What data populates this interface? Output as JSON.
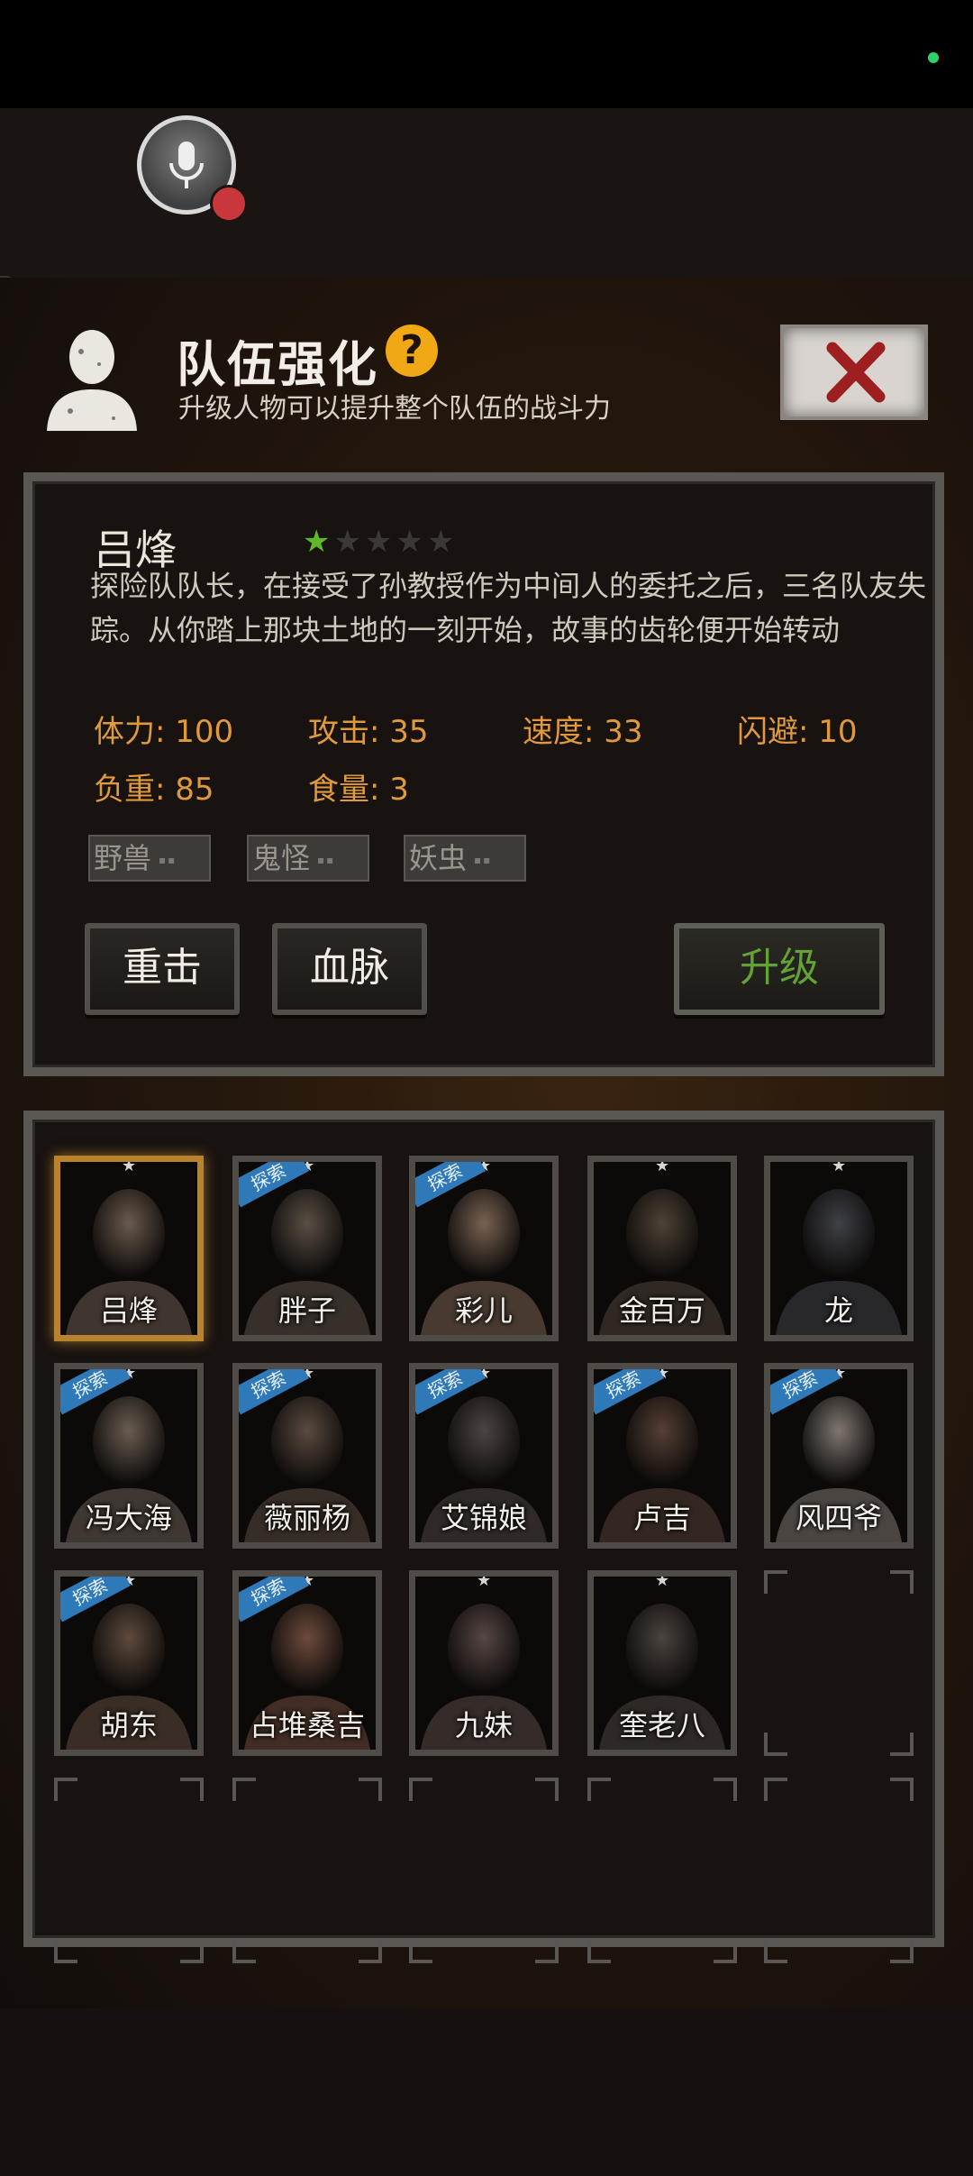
{
  "header": {
    "title": "队伍强化",
    "help_glyph": "?",
    "subtitle": "升级人物可以提升整个队伍的战斗力",
    "icons": [
      "profile-silhouette-icon",
      "help-icon",
      "close-icon",
      "microphone-muted-icon"
    ]
  },
  "character": {
    "name": "吕烽",
    "stars_total": 5,
    "stars_filled": 1,
    "description": "探险队队长，在接受了孙教授作为中间人的委托之后，三名队友失踪。从你踏上那块土地的一刻开始，故事的齿轮便开始转动",
    "stats": [
      {
        "label": "体力: 100"
      },
      {
        "label": "攻击: 35"
      },
      {
        "label": "速度: 33"
      },
      {
        "label": "闪避: 10"
      },
      {
        "label": "负重: 85"
      },
      {
        "label": "食量: 3"
      }
    ],
    "tags": [
      "野兽",
      "鬼怪",
      "妖虫"
    ],
    "tag_dots": "▪▪",
    "skills": [
      "重击",
      "血脉"
    ],
    "upgrade_label": "升级"
  },
  "roster": {
    "explore_badge": "探索",
    "star_glyph": "★",
    "members": [
      {
        "name": "吕烽",
        "explore": false,
        "selected": true
      },
      {
        "name": "胖子",
        "explore": true,
        "selected": false
      },
      {
        "name": "彩儿",
        "explore": true,
        "selected": false
      },
      {
        "name": "金百万",
        "explore": false,
        "selected": false
      },
      {
        "name": "龙",
        "explore": false,
        "selected": false
      },
      {
        "name": "冯大海",
        "explore": true,
        "selected": false
      },
      {
        "name": "薇丽杨",
        "explore": true,
        "selected": false
      },
      {
        "name": "艾锦娘",
        "explore": true,
        "selected": false
      },
      {
        "name": "卢吉",
        "explore": true,
        "selected": false
      },
      {
        "name": "风四爷",
        "explore": true,
        "selected": false
      },
      {
        "name": "胡东",
        "explore": true,
        "selected": false
      },
      {
        "name": "占堆桑吉",
        "explore": true,
        "selected": false
      },
      {
        "name": "九妹",
        "explore": false,
        "selected": false
      },
      {
        "name": "奎老八",
        "explore": false,
        "selected": false
      }
    ],
    "empty_slots": 6
  },
  "colors": {
    "stat_orange": "#e09a3c",
    "star_green": "#5fb82c",
    "upgrade_green": "#62a237",
    "explore_blue": "#2f79b8",
    "help_gold": "#f0a814"
  }
}
